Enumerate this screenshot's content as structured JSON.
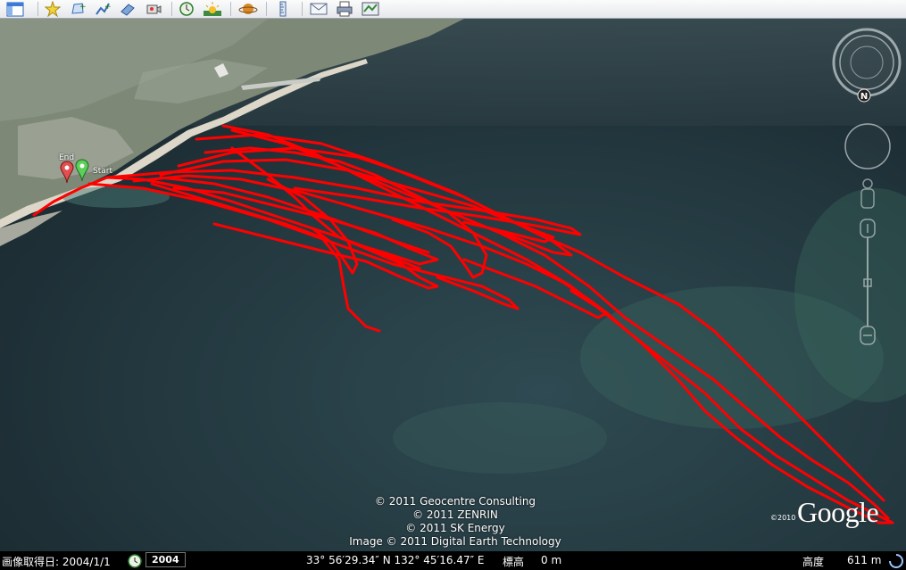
{
  "toolbar": {
    "buttons": [
      {
        "name": "sidebar-toggle-button",
        "icon": "sidebar-icon"
      },
      {
        "name": "add-placemark-button",
        "icon": "placemark-icon"
      },
      {
        "name": "add-polygon-button",
        "icon": "polygon-icon"
      },
      {
        "name": "add-path-button",
        "icon": "path-icon"
      },
      {
        "name": "add-image-overlay-button",
        "icon": "image-overlay-icon"
      },
      {
        "name": "record-tour-button",
        "icon": "record-tour-icon"
      },
      {
        "name": "historical-imagery-button",
        "icon": "clock-icon"
      },
      {
        "name": "sunlight-button",
        "icon": "sun-icon"
      },
      {
        "name": "switch-planet-button",
        "icon": "planet-icon"
      },
      {
        "name": "ruler-button",
        "icon": "ruler-icon"
      },
      {
        "name": "email-button",
        "icon": "email-icon"
      },
      {
        "name": "print-button",
        "icon": "print-icon"
      },
      {
        "name": "view-in-maps-button",
        "icon": "maps-icon"
      }
    ]
  },
  "map": {
    "pins": {
      "start_label": "Start",
      "end_label": "End"
    },
    "track_color": "#ff0000",
    "credits": [
      "© 2011 Geocentre Consulting",
      "© 2011 ZENRIN",
      "© 2011 SK Energy",
      "Image © 2011 Digital Earth Technology"
    ],
    "logo_year": "©2010",
    "logo_text": "Google"
  },
  "navigation": {
    "north_label": "N"
  },
  "status": {
    "imagery_date": "画像取得日: 2004/1/1",
    "history_year": "2004",
    "coordinates": "33° 56′29.34″ N 132° 45′16.47″ E",
    "elevation_label": "標高",
    "elevation_value": "0 m",
    "eye_alt_label": "高度",
    "eye_alt_value": "611 m"
  }
}
